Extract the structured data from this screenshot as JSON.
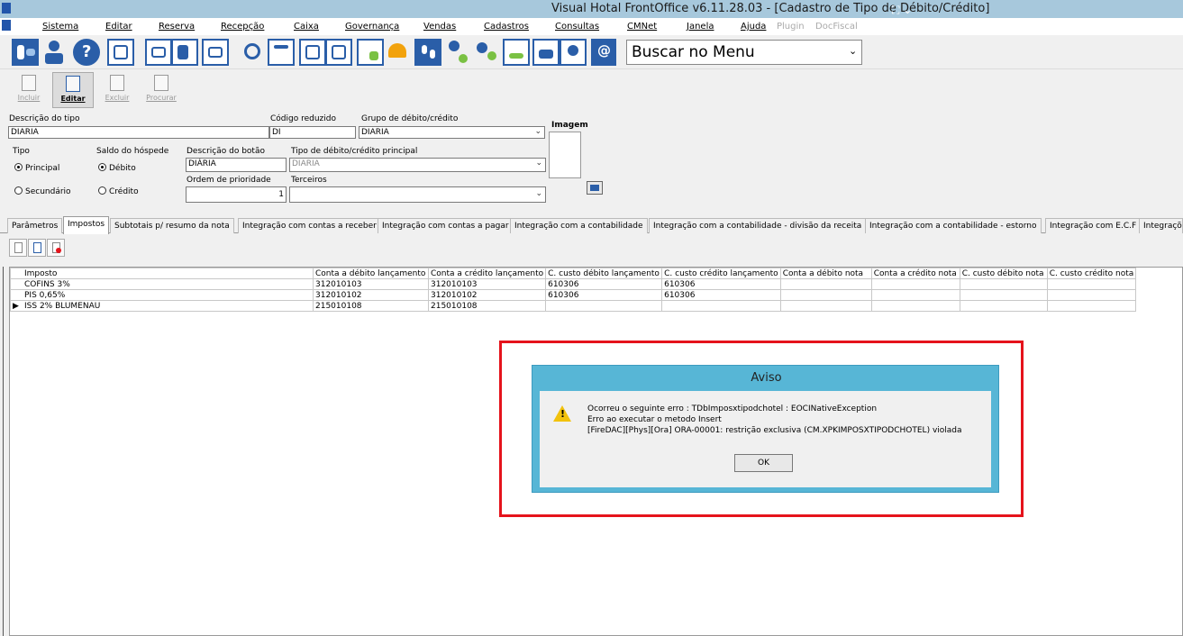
{
  "window": {
    "title": "Visual Hotal FrontOffice v6.11.28.03 - [Cadastro de Tipo de Débito/Crédito]"
  },
  "menu": {
    "items": [
      {
        "label": "Sistema"
      },
      {
        "label": "Editar"
      },
      {
        "label": "Reserva"
      },
      {
        "label": "Recepção"
      },
      {
        "label": "Caixa"
      },
      {
        "label": "Governança"
      },
      {
        "label": "Vendas"
      },
      {
        "label": "Cadastros"
      },
      {
        "label": "Consultas"
      },
      {
        "label": "CMNet"
      },
      {
        "label": "Janela"
      },
      {
        "label": "Ajuda"
      },
      {
        "label": "Plugin"
      },
      {
        "label": "DocFiscal"
      }
    ]
  },
  "iconbar": {
    "search_menu": "Buscar no Menu",
    "icons": [
      "exit-icon",
      "users-icon",
      "help-icon",
      "network-icon",
      "mail-icon",
      "edit-list-icon",
      "send-mail-icon",
      "search-icon",
      "calendar-icon",
      "room-grid-icon",
      "room-map-icon",
      "checklist-icon",
      "bell-icon",
      "footprints-icon",
      "add-guest-icon",
      "group-icon",
      "spreadsheet-icon",
      "cashier-icon",
      "staff-icon",
      "at-icon"
    ]
  },
  "toolbar": {
    "incluir": "Incluir",
    "editar": "Editar",
    "excluir": "Excluir",
    "procurar": "Procurar"
  },
  "form": {
    "descricao_tipo_label": "Descrição do tipo",
    "descricao_tipo_value": "DIARIA",
    "codigo_reduzido_label": "Código reduzido",
    "codigo_reduzido_value": "DI",
    "grupo_label": "Grupo de débito/crédito",
    "grupo_value": "DIARIA",
    "imagem_label": "Imagem",
    "tipo_label": "Tipo",
    "tipo_principal": "Principal",
    "tipo_secundario": "Secundário",
    "saldo_label": "Saldo do hóspede",
    "saldo_debito": "Débito",
    "saldo_credito": "Crédito",
    "descricao_botao_label": "Descrição do botão",
    "descricao_botao_value": "DIÁRIA",
    "tipo_principal_label": "Tipo de débito/crédito principal",
    "tipo_principal_value": "DIARIA",
    "ordem_label": "Ordem de prioridade",
    "ordem_value": "1",
    "terceiros_label": "Terceiros",
    "terceiros_value": ""
  },
  "tabs": [
    {
      "label": "Parâmetros"
    },
    {
      "label": "Impostos"
    },
    {
      "label": "Subtotais p/ resumo da nota"
    },
    {
      "label": "Integração com contas a receber"
    },
    {
      "label": "Integração com contas a pagar"
    },
    {
      "label": "Integração com a contabilidade"
    },
    {
      "label": "Integração com a contabilidade - divisão da receita"
    },
    {
      "label": "Integração com a contabilidade - estorno"
    },
    {
      "label": "Integração com E.C.F"
    },
    {
      "label": "Integraçõ"
    }
  ],
  "grid": {
    "columns": [
      "Imposto",
      "Conta a débito lançamento",
      "Conta a crédito lançamento",
      "C. custo débito lançamento",
      "C. custo crédito lançamento",
      "Conta a débito nota",
      "Conta a crédito nota",
      "C. custo débito nota",
      "C. custo crédito nota"
    ],
    "rows": [
      [
        "COFINS 3%",
        "312010103",
        "312010103",
        "610306",
        "610306",
        "",
        "",
        "",
        ""
      ],
      [
        "PIS 0,65%",
        "312010102",
        "312010102",
        "610306",
        "610306",
        "",
        "",
        "",
        ""
      ],
      [
        "ISS 2% BLUMENAU",
        "215010108",
        "215010108",
        "",
        "",
        "",
        "",
        "",
        ""
      ]
    ]
  },
  "dialog": {
    "title": "Aviso",
    "line1": "Ocorreu o seguinte erro : TDbImposxtipodchotel : EOCINativeException",
    "line2": "Erro ao executar o metodo Insert",
    "line3": "[FireDAC][Phys][Ora] ORA-00001: restrição exclusiva (CM.XPKIMPOSXTIPODCHOTEL) violada",
    "ok": "OK"
  },
  "colors": {
    "titlebar": "#a7c8dc",
    "dialog_frame": "#57b6d6",
    "highlight_box": "#e5131b",
    "icon_blue": "#2a5ea8",
    "warning": "#f2c20c"
  }
}
